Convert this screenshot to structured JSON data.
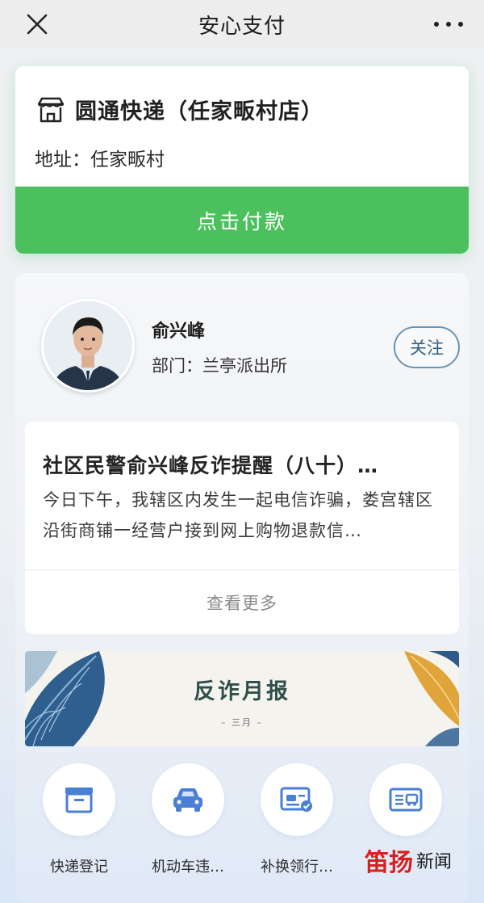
{
  "header": {
    "title": "安心支付",
    "close_icon": "close-icon",
    "more_icon": "more-icon"
  },
  "shop": {
    "icon": "store-icon",
    "name": "圆通快递（任家畈村店）",
    "address": "地址：任家畈村",
    "pay_label": "点击付款",
    "accent": "#4cc05c"
  },
  "officer": {
    "name": "俞兴峰",
    "department": "部门：兰亭派出所",
    "follow_label": "关注"
  },
  "notice": {
    "title": "社区民警俞兴峰反诈提醒（八十）…",
    "body": "今日下午，我辖区内发生一起电信诈骗，娄宫辖区沿街商铺一经营户接到网上购物退款信…",
    "more_label": "查看更多"
  },
  "banner": {
    "title": "反诈月报",
    "subtitle": "– 三月 –"
  },
  "services": [
    {
      "label": "快递登记",
      "icon": "package-register-icon"
    },
    {
      "label": "机动车违…",
      "icon": "car-icon"
    },
    {
      "label": "补换领行…",
      "icon": "license-card-icon"
    },
    {
      "label": "",
      "icon": "vehicle-document-icon"
    }
  ],
  "watermark": {
    "red": "笛扬",
    "dark": "新闻"
  }
}
